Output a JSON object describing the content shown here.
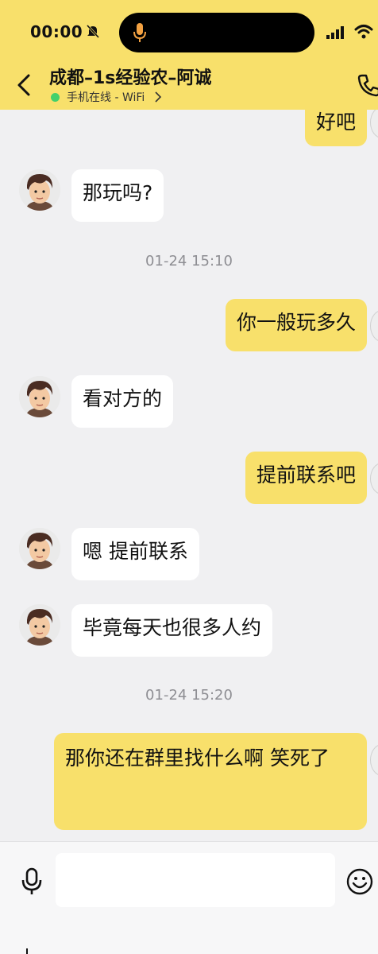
{
  "status_bar": {
    "time": "00:00"
  },
  "header": {
    "title": "成都–1s经验农–阿诚",
    "online_status": "手机在线 - WiFi"
  },
  "messages": [
    {
      "from": "me",
      "text": "好吧"
    },
    {
      "from": "other",
      "text": "那玩吗?"
    },
    {
      "type": "timestamp",
      "text": "01-24 15:10"
    },
    {
      "from": "me",
      "text": "你一般玩多久"
    },
    {
      "from": "other",
      "text": "看对方的"
    },
    {
      "from": "me",
      "text": "提前联系吧"
    },
    {
      "from": "other",
      "text": "嗯 提前联系"
    },
    {
      "from": "other",
      "text": "毕竟每天也很多人约"
    },
    {
      "type": "timestamp",
      "text": "01-24 15:20"
    },
    {
      "from": "me",
      "text": "那你还在群里找什么啊 笑死了"
    }
  ],
  "input": {
    "value": "",
    "placeholder": ""
  },
  "icons": [
    "mute-icon",
    "microphone-icon",
    "signal-icon",
    "wifi-icon",
    "back-icon",
    "chevron-right-icon",
    "phone-icon",
    "avatar",
    "voice-icon",
    "emoji-icon"
  ],
  "colors": {
    "header_bg": "#f8e06b",
    "outgoing_bubble": "#f8e06b",
    "incoming_bubble": "#ffffff",
    "chat_bg": "#f0f0f2",
    "online_dot": "#43d06b",
    "timestamp": "#8e8e93"
  }
}
